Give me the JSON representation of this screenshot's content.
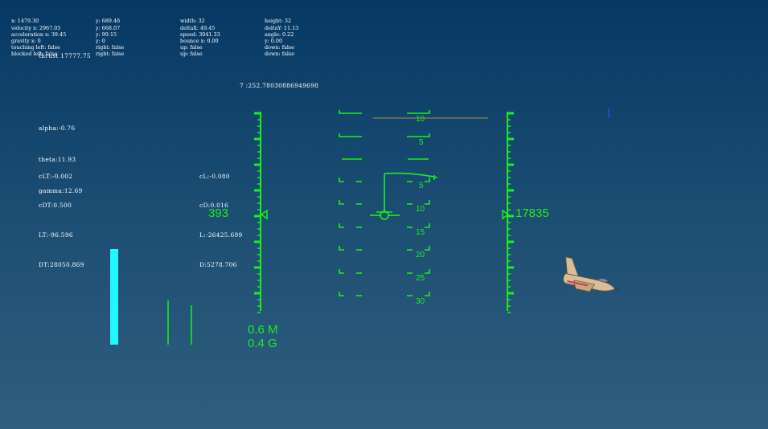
{
  "debug": {
    "col1": [
      "x: 1479.30",
      "velocity x: 2967.05",
      "acceleration x: 39.45",
      "gravity x: 0",
      "touching left: false",
      "blocked left: false"
    ],
    "col2": [
      "y: 689.46",
      "y: 668.07",
      "y: 99.15",
      "y: 0",
      "right: false",
      "right: false"
    ],
    "col3": [
      "width: 32",
      "deltaX: 49.45",
      "speed: 3041.33",
      "bounce x: 0.00",
      "up: false",
      "up: false"
    ],
    "col4": [
      "height: 32",
      "deltaY: 11.13",
      "angle: 0.22",
      "y: 0.00",
      "down: false",
      "down: false"
    ]
  },
  "thrust": "thrust 17777.75",
  "timer": "7 :252.78030886949698",
  "angles": [
    "alpha:-0.76",
    "theta:11.93",
    "gamma:12.69"
  ],
  "coeffs_left": [
    "cLT:-0.002",
    "cDT:0.500",
    "LT:-96.596",
    "DT:28050.869"
  ],
  "coeffs_right": [
    "cL:-0.080",
    "cD:0.016",
    "L:-26425.699",
    "D:5278.706"
  ],
  "hud": {
    "airspeed": "393",
    "altitude": "17835",
    "mach": "0.6 M",
    "g": "0.4 G",
    "pitch_labels": [
      "10",
      "5",
      "5",
      "10",
      "15",
      "20",
      "25",
      "30"
    ],
    "color": "#19f01b",
    "throttle_level": 0.78
  },
  "colors": {
    "throttle": "#22f7ff",
    "horizon": "#a6943f",
    "sky_top": "#053864",
    "sky_bottom": "#2f5e7e"
  },
  "icons": {
    "aircraft": "fighter-jet-icon"
  }
}
